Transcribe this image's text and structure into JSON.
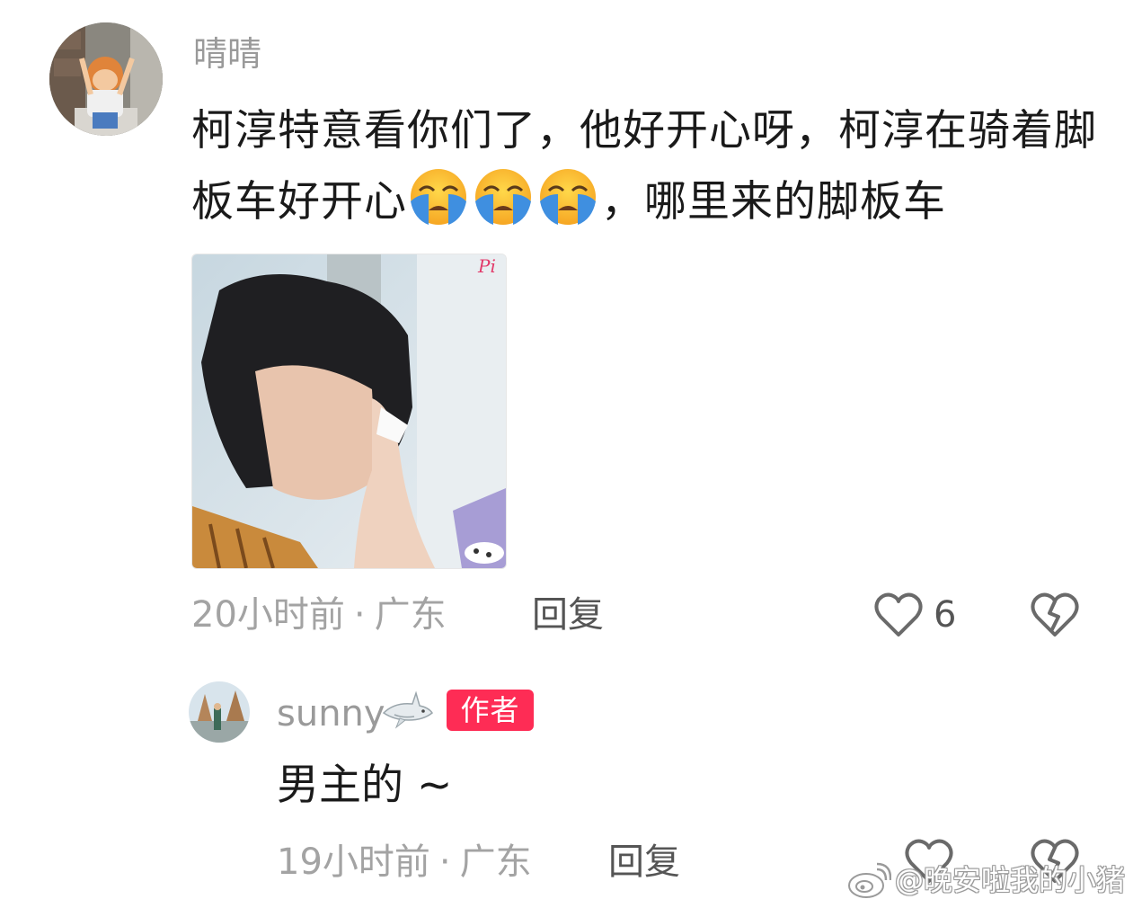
{
  "comment": {
    "username": "晴晴",
    "text_part1": "柯淳特意看你们了，他好开心呀，柯淳在骑着脚板车好开心",
    "emoji": "loudly-crying-face-icon",
    "emoji_count": 3,
    "text_part2": "，哪里来的脚板车",
    "time": "20小时前",
    "separator": "·",
    "location": "广东",
    "reply_label": "回复",
    "like_count": "6"
  },
  "reply": {
    "username": "sunny",
    "username_icon": "shark-icon",
    "badge": "作者",
    "text": "男主的 ~",
    "time": "19小时前",
    "separator": "·",
    "location": "广东",
    "reply_label": "回复"
  },
  "watermark": {
    "icon": "weibo-icon",
    "text": "@晚安啦我的小猪"
  },
  "colors": {
    "badge": "#fe2c55",
    "meta_text": "#a3a3a3",
    "username": "#9a9a9a",
    "body_text": "#1a1a1a"
  }
}
